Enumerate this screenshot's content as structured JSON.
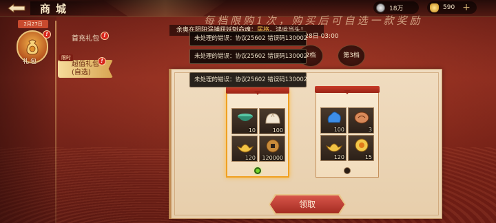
{
  "topbar": {
    "title": "商城",
    "currencies": [
      {
        "name": "coin",
        "value": "18万",
        "icon": "coin-icon",
        "color": "#c8c8c8"
      },
      {
        "name": "gold",
        "value": "590",
        "icon": "gold-ingot-icon",
        "color": "#e8b440"
      }
    ],
    "add_label": "+"
  },
  "left_menu": {
    "date_chip": "2月27日",
    "gift_label": "礼包",
    "badge": "!"
  },
  "sub_menu": {
    "items": [
      {
        "label": "首充礼包"
      },
      {
        "label": "超值礼包",
        "sub": "(自选)",
        "tag": "限时",
        "active": true
      }
    ]
  },
  "banner": {
    "headline": "每档限购1次，购买后可自选一款奖励",
    "marquee_prefix": "余奥在阴阳涡捕获妖魁命魂：",
    "marquee_highlight": "居格",
    "marquee_suffix": "，鸿运当头！",
    "time": "~2月28日 03:00"
  },
  "tiers": [
    {
      "label": "2档"
    },
    {
      "label": "第3档"
    }
  ],
  "toasts": [
    "未处理的错误：协议25602  错误码130002",
    "未处理的错误：协议25602  错误码130002",
    "未处理的错误：协议25602  错误码130002"
  ],
  "cards": [
    {
      "selected": true,
      "items": [
        {
          "icon": "jade-bowl-icon",
          "qty": "10"
        },
        {
          "icon": "bun-icon",
          "qty": "100"
        },
        {
          "icon": "gold-ingot-icon",
          "qty": "120"
        },
        {
          "icon": "copper-coin-icon",
          "qty": "120000"
        }
      ]
    },
    {
      "selected": false,
      "items": [
        {
          "icon": "blue-spirit-icon",
          "qty": "100"
        },
        {
          "icon": "talisman-icon",
          "qty": "3"
        },
        {
          "icon": "gold-ingot-icon",
          "qty": "120"
        },
        {
          "icon": "golden-medallion-icon",
          "qty": "15"
        }
      ]
    }
  ],
  "claim_label": "领取",
  "colors": {
    "accent": "#f0a020",
    "radio_on": "#71d52a",
    "highlight": "#f5c24e"
  }
}
